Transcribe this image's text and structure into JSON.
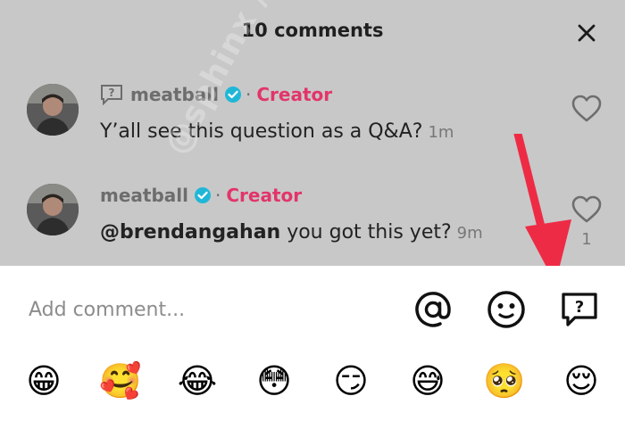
{
  "header": {
    "title": "10 comments"
  },
  "comments": [
    {
      "username": "meatball",
      "badge": "Creator",
      "dot": "·",
      "text": "Y’all see this question as a Q&A?",
      "time": "1m"
    },
    {
      "username": "meatball",
      "badge": "Creator",
      "dot": "·",
      "mention": "@brendangahan",
      "text": " you got this yet?",
      "time": "9m",
      "likes": "1"
    }
  ],
  "watermark": "@sphinx / @m...",
  "composer": {
    "placeholder": "Add comment...",
    "icons": [
      "at-icon",
      "emoji-face-icon",
      "question-icon"
    ]
  },
  "emojis": [
    "😁",
    "🥰",
    "😂",
    "😳",
    "😏",
    "😅",
    "🥺",
    "😌"
  ],
  "colors": {
    "creator": "#e2356a",
    "verified": "#20b7d7",
    "arrow": "#ee2b45"
  }
}
